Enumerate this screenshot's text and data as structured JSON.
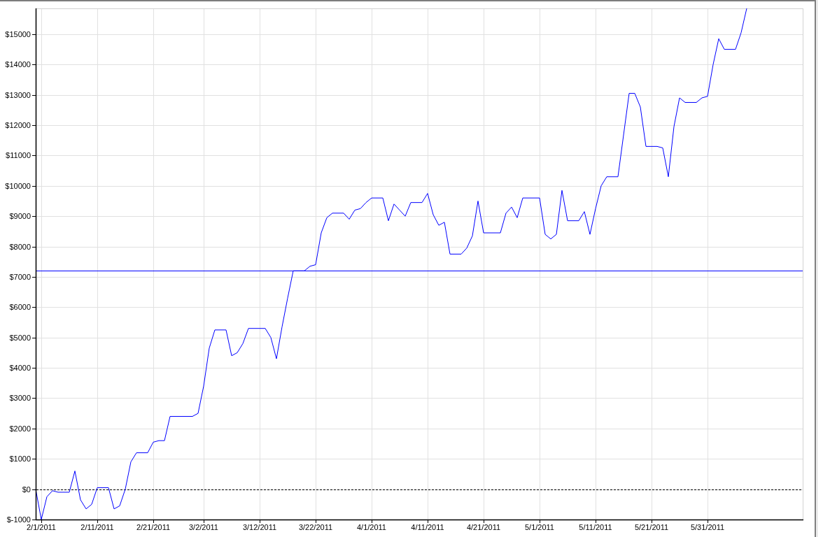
{
  "chart": {
    "chart_data": {
      "type": "line",
      "grid": true,
      "x": [
        "2011-01-31",
        "2011-02-01",
        "2011-02-02",
        "2011-02-03",
        "2011-02-04",
        "2011-02-06",
        "2011-02-07",
        "2011-02-08",
        "2011-02-09",
        "2011-02-10",
        "2011-02-11",
        "2011-02-13",
        "2011-02-14",
        "2011-02-15",
        "2011-02-16",
        "2011-02-17",
        "2011-02-18",
        "2011-02-20",
        "2011-02-21",
        "2011-02-22",
        "2011-02-23",
        "2011-02-24",
        "2011-02-28",
        "2011-03-01",
        "2011-03-02",
        "2011-03-03",
        "2011-03-04",
        "2011-03-06",
        "2011-03-07",
        "2011-03-08",
        "2011-03-09",
        "2011-03-10",
        "2011-03-13",
        "2011-03-14",
        "2011-03-15",
        "2011-03-16",
        "2011-03-17",
        "2011-03-18",
        "2011-03-20",
        "2011-03-21",
        "2011-03-22",
        "2011-03-23",
        "2011-03-24",
        "2011-03-25",
        "2011-03-27",
        "2011-03-28",
        "2011-03-29",
        "2011-03-30",
        "2011-03-31",
        "2011-04-01",
        "2011-04-03",
        "2011-04-04",
        "2011-04-05",
        "2011-04-06",
        "2011-04-07",
        "2011-04-08",
        "2011-04-10",
        "2011-04-11",
        "2011-04-12",
        "2011-04-13",
        "2011-04-14",
        "2011-04-15",
        "2011-04-17",
        "2011-04-18",
        "2011-04-19",
        "2011-04-20",
        "2011-04-21",
        "2011-04-24",
        "2011-04-25",
        "2011-04-26",
        "2011-04-27",
        "2011-04-28",
        "2011-04-29",
        "2011-05-01",
        "2011-05-02",
        "2011-05-03",
        "2011-05-04",
        "2011-05-05",
        "2011-05-06",
        "2011-05-08",
        "2011-05-09",
        "2011-05-10",
        "2011-05-11",
        "2011-05-12",
        "2011-05-13",
        "2011-05-15",
        "2011-05-17",
        "2011-05-18",
        "2011-05-19",
        "2011-05-20",
        "2011-05-22",
        "2011-05-23",
        "2011-05-24",
        "2011-05-25",
        "2011-05-26",
        "2011-05-27",
        "2011-05-29",
        "2011-05-30",
        "2011-05-31",
        "2011-06-01",
        "2011-06-02",
        "2011-06-03",
        "2011-06-05",
        "2011-06-06",
        "2011-06-07"
      ],
      "series": [
        {
          "color": "#0000ff",
          "values": [
            0,
            -1000,
            -250,
            -50,
            -100,
            -100,
            600,
            -350,
            -650,
            -500,
            50,
            50,
            -650,
            -550,
            0,
            900,
            1200,
            1200,
            1550,
            1600,
            1600,
            2400,
            2400,
            2500,
            3400,
            4650,
            5250,
            5250,
            4400,
            4500,
            4800,
            5300,
            5300,
            5000,
            4300,
            5350,
            6300,
            7200,
            7200,
            7350,
            7400,
            8450,
            8950,
            9100,
            9100,
            8900,
            9200,
            9250,
            9450,
            9600,
            9600,
            8850,
            9400,
            9200,
            9000,
            9450,
            9450,
            9750,
            9050,
            8700,
            8800,
            7750,
            7750,
            7950,
            8350,
            9500,
            8450,
            8450,
            9100,
            9300,
            8950,
            9600,
            9600,
            9600,
            8400,
            8250,
            8400,
            9850,
            8850,
            8850,
            9150,
            8400,
            9250,
            10000,
            10300,
            10300,
            13050,
            13050,
            12600,
            11300,
            11300,
            11250,
            10300,
            11950,
            12900,
            12750,
            12750,
            12900,
            12950,
            14000,
            14850,
            14500,
            14500,
            15050,
            15850
          ]
        }
      ],
      "xlim": [
        "2011-01-31",
        "2011-06-17"
      ],
      "ylim": [
        -1000,
        15850
      ],
      "xticks": [
        {
          "value": "2011-02-01",
          "label": "2/1/2011"
        },
        {
          "value": "2011-02-11",
          "label": "2/11/2011"
        },
        {
          "value": "2011-02-21",
          "label": "2/21/2011"
        },
        {
          "value": "2011-03-02",
          "label": "3/2/2011"
        },
        {
          "value": "2011-03-12",
          "label": "3/12/2011"
        },
        {
          "value": "2011-03-22",
          "label": "3/22/2011"
        },
        {
          "value": "2011-04-01",
          "label": "4/1/2011"
        },
        {
          "value": "2011-04-11",
          "label": "4/11/2011"
        },
        {
          "value": "2011-04-21",
          "label": "4/21/2011"
        },
        {
          "value": "2011-05-01",
          "label": "5/1/2011"
        },
        {
          "value": "2011-05-11",
          "label": "5/11/2011"
        },
        {
          "value": "2011-05-21",
          "label": "5/21/2011"
        },
        {
          "value": "2011-05-31",
          "label": "5/31/2011"
        }
      ],
      "yticks": [
        {
          "value": -1000,
          "label": "$-1000"
        },
        {
          "value": 0,
          "label": "$0"
        },
        {
          "value": 1000,
          "label": "$1000"
        },
        {
          "value": 2000,
          "label": "$2000"
        },
        {
          "value": 3000,
          "label": "$3000"
        },
        {
          "value": 4000,
          "label": "$4000"
        },
        {
          "value": 5000,
          "label": "$5000"
        },
        {
          "value": 6000,
          "label": "$6000"
        },
        {
          "value": 7000,
          "label": "$7000"
        },
        {
          "value": 8000,
          "label": "$8000"
        },
        {
          "value": 9000,
          "label": "$9000"
        },
        {
          "value": 10000,
          "label": "$10000"
        },
        {
          "value": 11000,
          "label": "$11000"
        },
        {
          "value": 12000,
          "label": "$12000"
        },
        {
          "value": 13000,
          "label": "$13000"
        },
        {
          "value": 14000,
          "label": "$14000"
        },
        {
          "value": 15000,
          "label": "$15000"
        }
      ],
      "ref_lines": [
        {
          "axis": "y",
          "value": 7200,
          "color": "#0000ff"
        },
        {
          "axis": "y",
          "value": 0,
          "color": "#000000"
        }
      ]
    }
  }
}
